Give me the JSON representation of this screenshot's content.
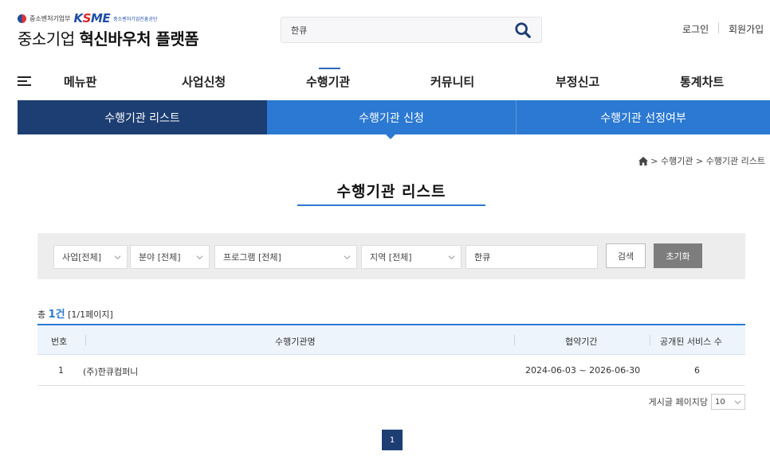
{
  "header": {
    "ministry": "중소벤처기업부",
    "kosme": "K",
    "kosme_s": "S",
    "kosme_me": "ME",
    "kosme_sub": "중소벤처기업진흥공단",
    "brand_light": "중소기업",
    "brand_bold": "혁신바우처 플랫폼",
    "search_value": "한큐",
    "login": "로그인",
    "join": "회원가입"
  },
  "nav": {
    "items": [
      "메뉴판",
      "사업신청",
      "수행기관",
      "커뮤니티",
      "부정신고",
      "통계차트"
    ],
    "active": "수행기관"
  },
  "subtabs": [
    "수행기관 리스트",
    "수행기관 신청",
    "수행기관 선정여부"
  ],
  "breadcrumb": "> 수행기관 > 수행기관 리스트",
  "page_title": "수행기관 리스트",
  "filter": {
    "business": "사업[전체]",
    "field": "분야 [전체]",
    "program": "프로그램 [전체]",
    "region": "지역 [전체]",
    "keyword": "한큐",
    "search_btn": "검색",
    "reset_btn": "초기화"
  },
  "count": {
    "prefix": "총",
    "num": "1건",
    "pages": "[1/1페이지]"
  },
  "table": {
    "headers": [
      "번호",
      "수행기관명",
      "협약기간",
      "공개된 서비스 수"
    ],
    "rows": [
      {
        "no": "1",
        "name": "(주)한큐컴퍼니",
        "period": "2024-06-03 ~ 2026-06-30",
        "services": "6"
      }
    ]
  },
  "per_page": {
    "label": "게시글 페이지당",
    "value": "10"
  },
  "pagination": {
    "current": "1"
  },
  "colors": {
    "navy": "#1c3e72",
    "blue": "#2b79d2",
    "accent_red": "#d9262c"
  }
}
